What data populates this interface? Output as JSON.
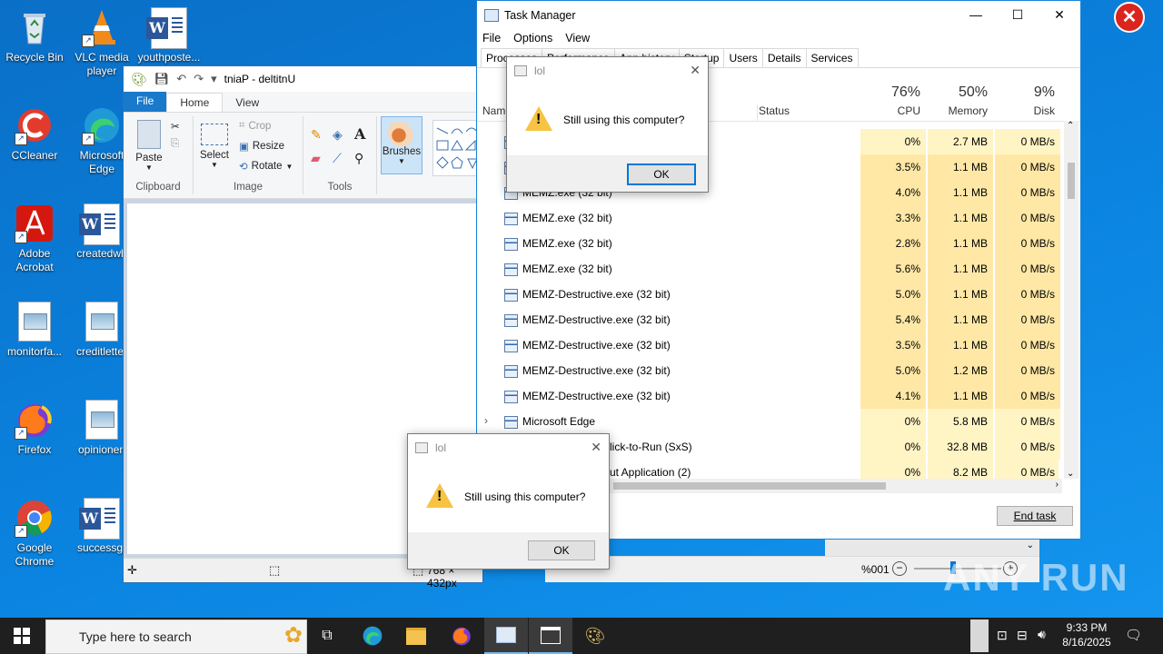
{
  "desktop_icons": [
    {
      "name": "recycle-bin",
      "label": "Recycle Bin"
    },
    {
      "name": "vlc",
      "label": "VLC media player"
    },
    {
      "name": "youthposte",
      "label": "youthposte..."
    },
    {
      "name": "ccleaner",
      "label": "CCleaner"
    },
    {
      "name": "edge",
      "label": "Microsoft Edge"
    },
    {
      "name": "acrobat",
      "label": "Adobe Acrobat"
    },
    {
      "name": "createdwh",
      "label": "createdwh"
    },
    {
      "name": "monitorfa",
      "label": "monitorfa..."
    },
    {
      "name": "creditletter",
      "label": "creditletter"
    },
    {
      "name": "firefox",
      "label": "Firefox"
    },
    {
      "name": "opinionen",
      "label": "opinionen"
    },
    {
      "name": "chrome",
      "label": "Google Chrome"
    },
    {
      "name": "successgr",
      "label": "successgr"
    }
  ],
  "paint": {
    "title": "tniaP - deltitnU",
    "tabs": {
      "file": "File",
      "home": "Home",
      "view": "View"
    },
    "clipboard": {
      "paste": "Paste",
      "group": "Clipboard"
    },
    "image": {
      "select": "Select",
      "crop": "Crop",
      "resize": "Resize",
      "rotate": "Rotate",
      "group": "Image"
    },
    "tools": {
      "group": "Tools"
    },
    "brushes": "Brushes",
    "status": {
      "size": "768 × 432px",
      "zoom": "%001"
    }
  },
  "taskmgr": {
    "title": "Task Manager",
    "menu": [
      "File",
      "Options",
      "View"
    ],
    "tabs": [
      "Processes",
      "Performance",
      "App history",
      "Startup",
      "Users",
      "Details",
      "Services"
    ],
    "headers": {
      "name": "Name",
      "status": "Status",
      "cpu_pct": "76%",
      "cpu": "CPU",
      "mem_pct": "50%",
      "mem": "Memory",
      "disk_pct": "9%",
      "disk": "Disk"
    },
    "rows": [
      {
        "name": "",
        "cpu": "0%",
        "mem": "2.7 MB",
        "disk": "0 MB/s"
      },
      {
        "name": "",
        "cpu": "3.5%",
        "mem": "1.1 MB",
        "disk": "0 MB/s"
      },
      {
        "name": "MEMZ.exe (32 bit)",
        "cpu": "4.0%",
        "mem": "1.1 MB",
        "disk": "0 MB/s"
      },
      {
        "name": "MEMZ.exe (32 bit)",
        "cpu": "3.3%",
        "mem": "1.1 MB",
        "disk": "0 MB/s"
      },
      {
        "name": "MEMZ.exe (32 bit)",
        "cpu": "2.8%",
        "mem": "1.1 MB",
        "disk": "0 MB/s"
      },
      {
        "name": "MEMZ.exe (32 bit)",
        "cpu": "5.6%",
        "mem": "1.1 MB",
        "disk": "0 MB/s"
      },
      {
        "name": "MEMZ-Destructive.exe (32 bit)",
        "cpu": "5.0%",
        "mem": "1.1 MB",
        "disk": "0 MB/s"
      },
      {
        "name": "MEMZ-Destructive.exe (32 bit)",
        "cpu": "5.4%",
        "mem": "1.1 MB",
        "disk": "0 MB/s"
      },
      {
        "name": "MEMZ-Destructive.exe (32 bit)",
        "cpu": "3.5%",
        "mem": "1.1 MB",
        "disk": "0 MB/s"
      },
      {
        "name": "MEMZ-Destructive.exe (32 bit)",
        "cpu": "5.0%",
        "mem": "1.2 MB",
        "disk": "0 MB/s"
      },
      {
        "name": "MEMZ-Destructive.exe (32 bit)",
        "cpu": "4.1%",
        "mem": "1.1 MB",
        "disk": "0 MB/s"
      },
      {
        "name": "Microsoft Edge",
        "cpu": "0%",
        "mem": "5.8 MB",
        "disk": "0 MB/s"
      },
      {
        "name": "lick-to-Run (SxS)",
        "cpu": "0%",
        "mem": "32.8 MB",
        "disk": "0 MB/s"
      },
      {
        "name": "ut Application (2)",
        "cpu": "0%",
        "mem": "8.2 MB",
        "disk": "0 MB/s"
      }
    ],
    "end_task": "End task"
  },
  "dialog1": {
    "title": "lol",
    "message": "Still using this computer?",
    "ok": "OK"
  },
  "dialog2": {
    "title": "lol",
    "message": "Still using this computer?",
    "ok": "OK"
  },
  "taskbar": {
    "search_placeholder": "Type here to search",
    "time": "9:33 PM",
    "date": "8/16/2025"
  },
  "watermark": "ANY RUN",
  "colors": {
    "accent": "#0078d7",
    "cpu_heat": "#fff4c4",
    "desktop": "#0a84e0"
  }
}
